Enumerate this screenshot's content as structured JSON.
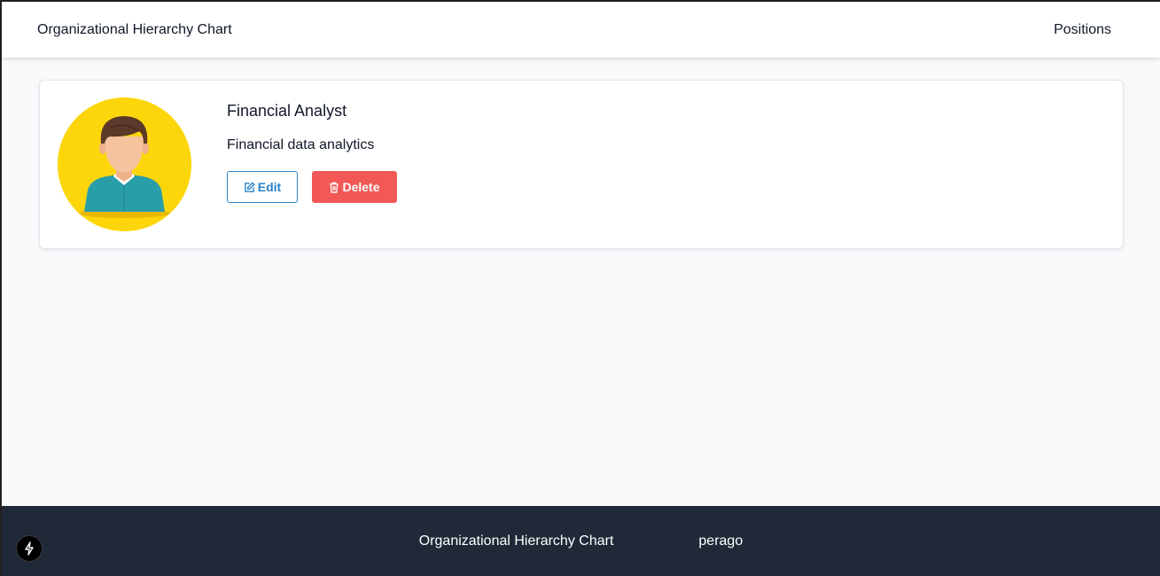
{
  "header": {
    "brand": "Organizational Hierarchy Chart",
    "nav_link": "Positions"
  },
  "position": {
    "title": "Financial Analyst",
    "description": "Financial data analytics",
    "edit_label": "Edit",
    "delete_label": "Delete",
    "edit_icon": "edit-icon",
    "delete_icon": "trash-icon",
    "avatar_icon": "person-avatar"
  },
  "footer": {
    "title": "Organizational Hierarchy Chart",
    "credit": "perago"
  },
  "colors": {
    "edit_accent": "#2a82c8",
    "delete_accent": "#f15856",
    "avatar_bg": "#fcd60b",
    "footer_bg": "#1f2937"
  }
}
